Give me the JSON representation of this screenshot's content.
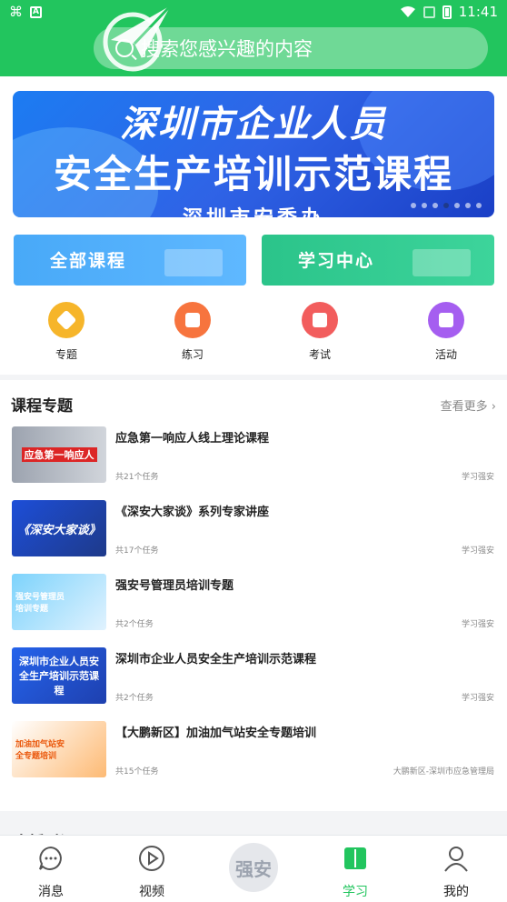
{
  "status_bar": {
    "time": "11:41"
  },
  "search": {
    "placeholder": "搜索您感兴趣的内容"
  },
  "banner": {
    "line1": "深圳市企业人员",
    "line2": "安全生产培训示范课程",
    "line3": "深圳市安委办",
    "slides": 7,
    "active_slide": 4
  },
  "cards": {
    "all_courses": "全部课程",
    "study_center": "学习中心"
  },
  "quick_links": [
    {
      "label": "专题",
      "icon": "topic-icon",
      "color": "#f6b52a"
    },
    {
      "label": "练习",
      "icon": "practice-icon",
      "color": "#f7743e"
    },
    {
      "label": "考试",
      "icon": "exam-icon",
      "color": "#f25d5d"
    },
    {
      "label": "活动",
      "icon": "activity-icon",
      "color": "#a55ef0"
    }
  ],
  "course_section": {
    "title": "课程专题",
    "more": "查看更多",
    "items": [
      {
        "title": "应急第一响应人线上理论课程",
        "tasks": "共21个任务",
        "source": "学习强安",
        "thumb_text": "应急第一响应人"
      },
      {
        "title": "《深安大家谈》系列专家讲座",
        "tasks": "共17个任务",
        "source": "学习强安",
        "thumb_text": "《深安大家谈》"
      },
      {
        "title": "强安号管理员培训专题",
        "tasks": "共2个任务",
        "source": "学习强安",
        "thumb_text": "强安号管理员培训专题"
      },
      {
        "title": "深圳市企业人员安全生产培训示范课程",
        "tasks": "共2个任务",
        "source": "学习强安",
        "thumb_text": "深圳市企业人员安全生产培训示范课程"
      },
      {
        "title": "【大鹏新区】加油加气站安全专题培训",
        "tasks": "共15个任务",
        "source": "大鹏新区-深圳市应急管理局",
        "thumb_text": "加油加气站安全专题培训"
      }
    ]
  },
  "next_section_title": "直播时讯",
  "tab_bar": {
    "items": [
      {
        "label": "消息",
        "icon": "message-icon",
        "active": false
      },
      {
        "label": "视频",
        "icon": "video-icon",
        "active": false
      },
      {
        "label": "学习",
        "icon": "study-icon",
        "active": true
      },
      {
        "label": "我的",
        "icon": "profile-icon",
        "active": false
      }
    ],
    "center_label": "强安"
  },
  "colors": {
    "primary": "#22c55e",
    "banner_blue": "#2f63e6"
  }
}
